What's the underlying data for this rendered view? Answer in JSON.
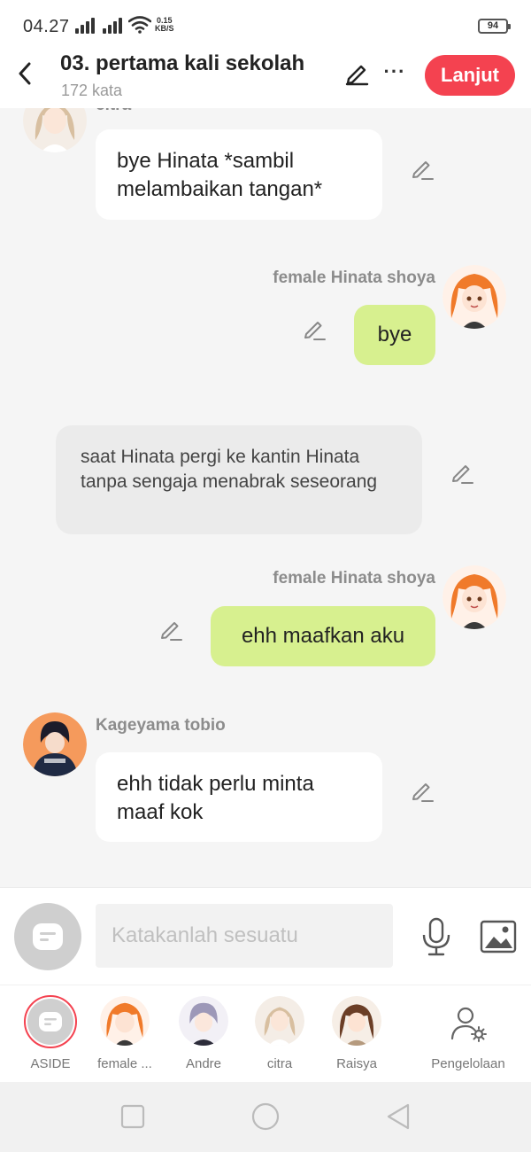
{
  "status_bar": {
    "time": "04.27",
    "net_speed_value": "0.15",
    "net_speed_unit": "KB/S",
    "battery": "94"
  },
  "header": {
    "title": "03. pertama kali sekolah",
    "word_count": "172 kata",
    "next_label": "Lanjut",
    "icons": [
      "back-arrow-icon",
      "pencil-icon",
      "more-icon"
    ],
    "accent_color": "#f44250"
  },
  "messages": [
    {
      "type": "left",
      "sender": "citra",
      "text": "bye Hinata *sambil melambaikan tangan*"
    },
    {
      "type": "right",
      "sender": "female Hinata shoya",
      "text": "bye"
    },
    {
      "type": "narration",
      "text": "saat Hinata pergi ke kantin Hinata tanpa sengaja menabrak seseorang"
    },
    {
      "type": "right",
      "sender": "female Hinata shoya",
      "text": "ehh maafkan aku"
    },
    {
      "type": "left",
      "sender": "Kageyama tobio",
      "text": "ehh tidak perlu minta maaf kok"
    }
  ],
  "composer": {
    "placeholder": "Katakanlah sesuatu",
    "icons": [
      "aside-chat-icon",
      "microphone-icon",
      "image-icon"
    ]
  },
  "characters": [
    {
      "label": "ASIDE",
      "selected": true
    },
    {
      "label": "female ..."
    },
    {
      "label": "Andre"
    },
    {
      "label": "citra"
    },
    {
      "label": "Raisya"
    },
    {
      "label": "Pengelolaan"
    }
  ],
  "colors": {
    "my_bubble": "#d7f08f",
    "other_bubble": "#ffffff",
    "narration_bubble": "#ebebeb"
  }
}
